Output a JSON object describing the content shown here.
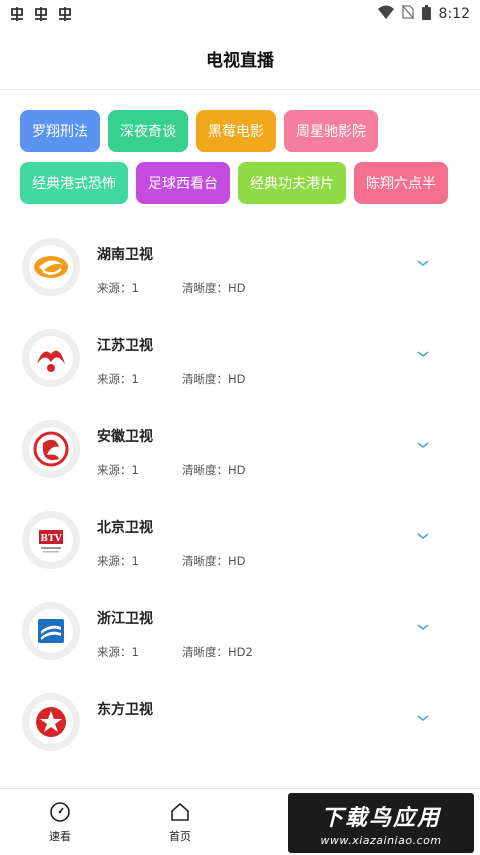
{
  "status_bar": {
    "time": "8:12",
    "left_icons": [
      "app-notification-icon",
      "app-notification-icon",
      "app-notification-icon"
    ],
    "right_icons": [
      "wifi-icon",
      "no-sim-icon",
      "battery-icon"
    ]
  },
  "header": {
    "title": "电视直播"
  },
  "tags": [
    {
      "label": "罗翔刑法",
      "color": "#5a93f0"
    },
    {
      "label": "深夜奇谈",
      "color": "#38d08e"
    },
    {
      "label": "黑莓电影",
      "color": "#efa81c"
    },
    {
      "label": "周星驰影院",
      "color": "#f57e9e"
    },
    {
      "label": "经典港式恐怖",
      "color": "#43d7a2"
    },
    {
      "label": "足球西看台",
      "color": "#c44de0"
    },
    {
      "label": "经典功夫港片",
      "color": "#8fda45"
    },
    {
      "label": "陈翔六点半",
      "color": "#f5708e"
    }
  ],
  "channels": [
    {
      "name": "湖南卫视",
      "source": "来源：1",
      "quality": "清晰度：HD"
    },
    {
      "name": "江苏卫视",
      "source": "来源：1",
      "quality": "清晰度：HD"
    },
    {
      "name": "安徽卫视",
      "source": "来源：1",
      "quality": "清晰度：HD"
    },
    {
      "name": "北京卫视",
      "source": "来源：1",
      "quality": "清晰度：HD"
    },
    {
      "name": "浙江卫视",
      "source": "来源：1",
      "quality": "清晰度：HD2"
    },
    {
      "name": "东方卫视",
      "source": "",
      "quality": ""
    }
  ],
  "logo_text": {
    "btv": "BTV"
  },
  "bottom_nav": [
    {
      "label": "速看",
      "icon": "compass-icon"
    },
    {
      "label": "首页",
      "icon": "home-icon"
    }
  ],
  "watermark": {
    "title": "下载鸟应用",
    "url": "www.xiazainiao.com"
  },
  "colors": {
    "chevron": "#4aa8c9",
    "accent_bar": "#ececec"
  }
}
